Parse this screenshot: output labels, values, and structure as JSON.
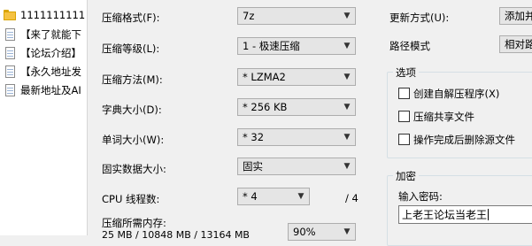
{
  "file_list": [
    {
      "type": "folder",
      "icon": "folder-icon",
      "name": "1111111111"
    },
    {
      "type": "file",
      "icon": "text-file-icon",
      "name": "【来了就能下"
    },
    {
      "type": "file",
      "icon": "text-file-icon",
      "name": "【论坛介绍】"
    },
    {
      "type": "file",
      "icon": "text-file-icon",
      "name": "【永久地址发"
    },
    {
      "type": "file",
      "icon": "text-file-icon",
      "name": "最新地址及AI"
    }
  ],
  "form": {
    "archive_format": {
      "label": "压缩格式(F):",
      "value": "7z"
    },
    "compression_level": {
      "label": "压缩等级(L):",
      "value": "1 - 极速压缩"
    },
    "compression_method": {
      "label": "压缩方法(M):",
      "value": "* LZMA2"
    },
    "dictionary_size": {
      "label": "字典大小(D):",
      "value": "* 256 KB"
    },
    "word_size": {
      "label": "单词大小(W):",
      "value": "* 32"
    },
    "solid_block_size": {
      "label": "固实数据大小:",
      "value": "固实"
    },
    "cpu_threads": {
      "label": "CPU 线程数:",
      "value": "* 4",
      "max": "/ 4"
    },
    "memory_usage": {
      "label": "压缩所需内存:",
      "detail": "25 MB / 10848 MB / 13164 MB",
      "percent": "90%"
    }
  },
  "right": {
    "update_mode": {
      "label": "更新方式(U):",
      "value": "添加并"
    },
    "path_mode": {
      "label": "路径模式",
      "value": "相对路"
    },
    "options": {
      "title": "选项",
      "checkboxes": [
        {
          "label": "创建自解压程序(X)",
          "checked": false
        },
        {
          "label": "压缩共享文件",
          "checked": false
        },
        {
          "label": "操作完成后删除源文件",
          "checked": false
        }
      ]
    },
    "encryption": {
      "title": "加密",
      "password_label": "输入密码:",
      "password_value": "上老王论坛当老王"
    }
  }
}
